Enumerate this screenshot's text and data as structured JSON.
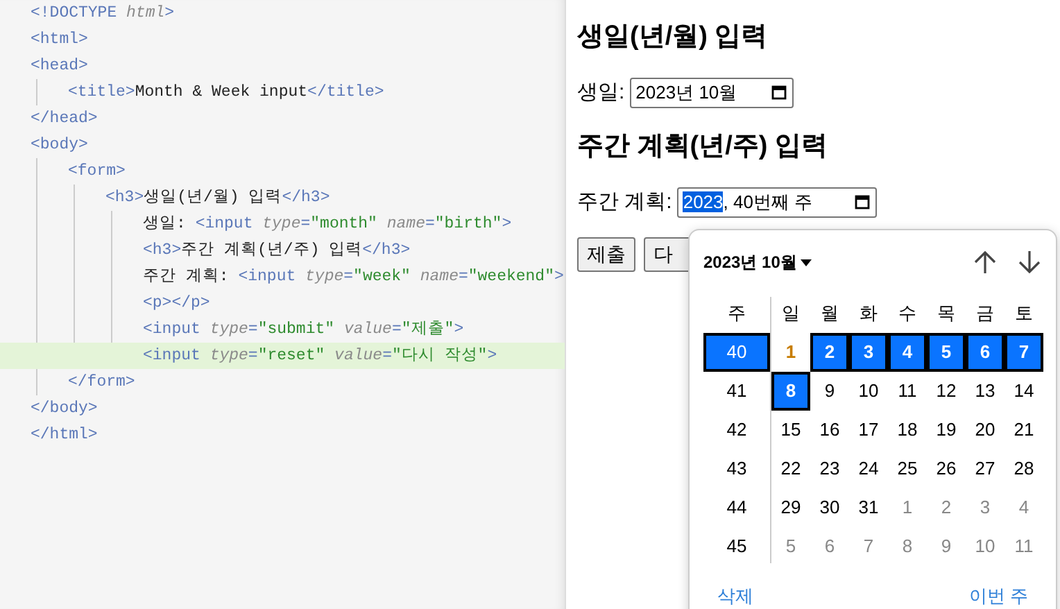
{
  "editor": {
    "lines": [
      {
        "tokens": [
          {
            "t": "<!DOCTYPE ",
            "kind": "tag"
          },
          {
            "t": "html",
            "kind": "attr"
          },
          {
            "t": ">",
            "kind": "tag"
          }
        ]
      },
      {
        "tokens": [
          {
            "t": "<html>",
            "kind": "tag"
          }
        ]
      },
      {
        "tokens": [
          {
            "t": "<head>",
            "kind": "tag"
          }
        ],
        "children": [
          {
            "tokens": [
              {
                "t": "<title>",
                "kind": "tag"
              },
              {
                "t": "Month & Week input",
                "kind": "text"
              },
              {
                "t": "</title>",
                "kind": "tag"
              }
            ]
          }
        ]
      },
      {
        "tokens": [
          {
            "t": "</head>",
            "kind": "tag"
          }
        ]
      },
      {
        "tokens": [
          {
            "t": "<body>",
            "kind": "tag"
          }
        ],
        "children": [
          {
            "tokens": [
              {
                "t": "<form>",
                "kind": "tag"
              }
            ],
            "children": [
              {
                "tokens": [
                  {
                    "t": "<h3>",
                    "kind": "tag"
                  },
                  {
                    "t": "생일(년/월) 입력",
                    "kind": "text"
                  },
                  {
                    "t": "</h3>",
                    "kind": "tag"
                  }
                ],
                "children": [
                  {
                    "tokens": [
                      {
                        "t": "생일: ",
                        "kind": "text"
                      },
                      {
                        "t": "<input ",
                        "kind": "tag"
                      },
                      {
                        "t": "type",
                        "kind": "attr"
                      },
                      {
                        "t": "=",
                        "kind": "tag"
                      },
                      {
                        "t": "\"month\" ",
                        "kind": "value"
                      },
                      {
                        "t": "name",
                        "kind": "attr"
                      },
                      {
                        "t": "=",
                        "kind": "tag"
                      },
                      {
                        "t": "\"birth\"",
                        "kind": "value"
                      },
                      {
                        "t": ">",
                        "kind": "tag"
                      }
                    ]
                  },
                  {
                    "tokens": [
                      {
                        "t": "<h3>",
                        "kind": "tag"
                      },
                      {
                        "t": "주간 계획(년/주) 입력",
                        "kind": "text"
                      },
                      {
                        "t": "</h3>",
                        "kind": "tag"
                      }
                    ]
                  },
                  {
                    "tokens": [
                      {
                        "t": "주간 계획: ",
                        "kind": "text"
                      },
                      {
                        "t": "<input ",
                        "kind": "tag"
                      },
                      {
                        "t": "type",
                        "kind": "attr"
                      },
                      {
                        "t": "=",
                        "kind": "tag"
                      },
                      {
                        "t": "\"week\" ",
                        "kind": "value"
                      },
                      {
                        "t": "name",
                        "kind": "attr"
                      },
                      {
                        "t": "=",
                        "kind": "tag"
                      },
                      {
                        "t": "\"weekend\"",
                        "kind": "value"
                      },
                      {
                        "t": ">",
                        "kind": "tag"
                      }
                    ]
                  },
                  {
                    "tokens": [
                      {
                        "t": "<p></p>",
                        "kind": "tag"
                      }
                    ]
                  },
                  {
                    "tokens": [
                      {
                        "t": "<input ",
                        "kind": "tag"
                      },
                      {
                        "t": "type",
                        "kind": "attr"
                      },
                      {
                        "t": "=",
                        "kind": "tag"
                      },
                      {
                        "t": "\"submit\" ",
                        "kind": "value"
                      },
                      {
                        "t": "value",
                        "kind": "attr"
                      },
                      {
                        "t": "=",
                        "kind": "tag"
                      },
                      {
                        "t": "\"제출\"",
                        "kind": "value"
                      },
                      {
                        "t": ">",
                        "kind": "tag"
                      }
                    ]
                  },
                  {
                    "highlighted": true,
                    "tokens": [
                      {
                        "t": "<input ",
                        "kind": "tag"
                      },
                      {
                        "t": "type",
                        "kind": "attr"
                      },
                      {
                        "t": "=",
                        "kind": "tag"
                      },
                      {
                        "t": "\"reset\" ",
                        "kind": "value"
                      },
                      {
                        "t": "value",
                        "kind": "attr"
                      },
                      {
                        "t": "=",
                        "kind": "tag"
                      },
                      {
                        "t": "\"다시 작성\"",
                        "kind": "value"
                      },
                      {
                        "t": ">",
                        "kind": "tag"
                      }
                    ]
                  }
                ]
              }
            ]
          },
          {
            "tokens": [
              {
                "t": "</form>",
                "kind": "tag"
              }
            ]
          }
        ]
      },
      {
        "tokens": [
          {
            "t": "</body>",
            "kind": "tag"
          }
        ]
      },
      {
        "tokens": [
          {
            "t": "</html>",
            "kind": "tag"
          }
        ]
      }
    ]
  },
  "preview": {
    "heading_month": "생일(년/월) 입력",
    "month_label": "생일:",
    "month_value": "2023년 10월",
    "heading_week": "주간 계획(년/주) 입력",
    "week_label": "주간 계획:",
    "week_value": [
      {
        "text": "2023",
        "selected": true
      },
      {
        "text": ", 40번째 주",
        "selected": false
      }
    ],
    "buttons": [
      "제출",
      "다"
    ],
    "picker": {
      "month_title": "2023년 10월",
      "week_header": "주",
      "weekdays": [
        "일",
        "월",
        "화",
        "수",
        "목",
        "금",
        "토"
      ],
      "weeks": [
        {
          "number": "40",
          "selected": true,
          "days": [
            {
              "text": "1",
              "kind": "today",
              "selected": false
            },
            {
              "text": "2",
              "kind": "current",
              "selected": true
            },
            {
              "text": "3",
              "kind": "current",
              "selected": true
            },
            {
              "text": "4",
              "kind": "current",
              "selected": true
            },
            {
              "text": "5",
              "kind": "current",
              "selected": true
            },
            {
              "text": "6",
              "kind": "current",
              "selected": true
            },
            {
              "text": "7",
              "kind": "current",
              "selected": true
            }
          ]
        },
        {
          "number": "41",
          "selected": false,
          "days": [
            {
              "text": "8",
              "kind": "current",
              "selected": true
            },
            {
              "text": "9",
              "kind": "current",
              "selected": false
            },
            {
              "text": "10",
              "kind": "current",
              "selected": false
            },
            {
              "text": "11",
              "kind": "current",
              "selected": false
            },
            {
              "text": "12",
              "kind": "current",
              "selected": false
            },
            {
              "text": "13",
              "kind": "current",
              "selected": false
            },
            {
              "text": "14",
              "kind": "current",
              "selected": false
            }
          ]
        },
        {
          "number": "42",
          "selected": false,
          "days": [
            {
              "text": "15",
              "kind": "current",
              "selected": false
            },
            {
              "text": "16",
              "kind": "current",
              "selected": false
            },
            {
              "text": "17",
              "kind": "current",
              "selected": false
            },
            {
              "text": "18",
              "kind": "current",
              "selected": false
            },
            {
              "text": "19",
              "kind": "current",
              "selected": false
            },
            {
              "text": "20",
              "kind": "current",
              "selected": false
            },
            {
              "text": "21",
              "kind": "current",
              "selected": false
            }
          ]
        },
        {
          "number": "43",
          "selected": false,
          "days": [
            {
              "text": "22",
              "kind": "current",
              "selected": false
            },
            {
              "text": "23",
              "kind": "current",
              "selected": false
            },
            {
              "text": "24",
              "kind": "current",
              "selected": false
            },
            {
              "text": "25",
              "kind": "current",
              "selected": false
            },
            {
              "text": "26",
              "kind": "current",
              "selected": false
            },
            {
              "text": "27",
              "kind": "current",
              "selected": false
            },
            {
              "text": "28",
              "kind": "current",
              "selected": false
            }
          ]
        },
        {
          "number": "44",
          "selected": false,
          "days": [
            {
              "text": "29",
              "kind": "current",
              "selected": false
            },
            {
              "text": "30",
              "kind": "current",
              "selected": false
            },
            {
              "text": "31",
              "kind": "current",
              "selected": false
            },
            {
              "text": "1",
              "kind": "other",
              "selected": false
            },
            {
              "text": "2",
              "kind": "other",
              "selected": false
            },
            {
              "text": "3",
              "kind": "other",
              "selected": false
            },
            {
              "text": "4",
              "kind": "other",
              "selected": false
            }
          ]
        },
        {
          "number": "45",
          "selected": false,
          "days": [
            {
              "text": "5",
              "kind": "other",
              "selected": false
            },
            {
              "text": "6",
              "kind": "other",
              "selected": false
            },
            {
              "text": "7",
              "kind": "other",
              "selected": false
            },
            {
              "text": "8",
              "kind": "other",
              "selected": false
            },
            {
              "text": "9",
              "kind": "other",
              "selected": false
            },
            {
              "text": "10",
              "kind": "other",
              "selected": false
            },
            {
              "text": "11",
              "kind": "other",
              "selected": false
            }
          ]
        }
      ],
      "clear_link": "삭제",
      "this_week_link": "이번 주"
    }
  }
}
